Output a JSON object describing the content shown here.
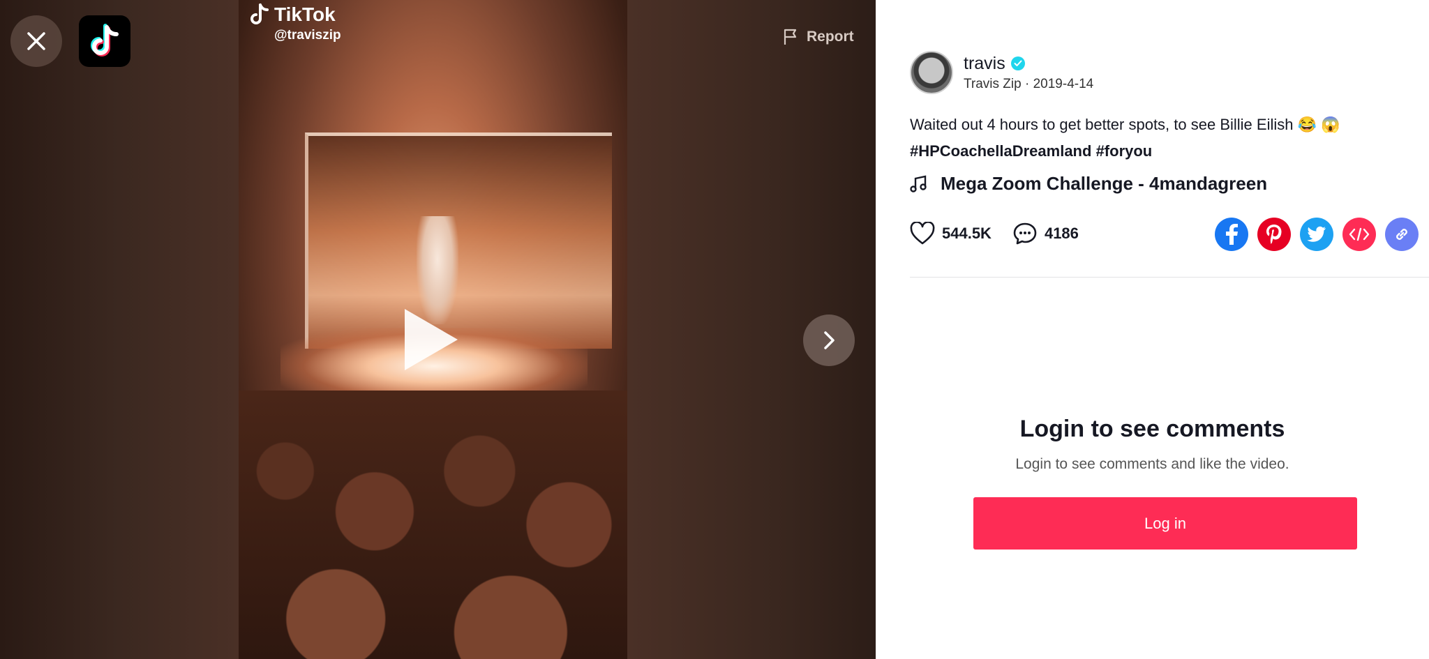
{
  "video": {
    "watermark_brand": "TikTok",
    "watermark_handle": "@traviszip",
    "report_label": "Report"
  },
  "author": {
    "username": "travis",
    "display_name": "Travis Zip",
    "date": "2019-4-14",
    "verified": true
  },
  "caption": {
    "text": "Waited out 4 hours to get better spots, to see Billie Eilish 😂 😱",
    "hashtags": [
      "#HPCoachellaDreamland",
      "#foryou"
    ]
  },
  "music": {
    "title": "Mega Zoom Challenge - 4mandagreen"
  },
  "stats": {
    "likes": "544.5K",
    "comments": "4186"
  },
  "share": [
    {
      "name": "facebook",
      "color": "#1877f2"
    },
    {
      "name": "pinterest",
      "color": "#e60023"
    },
    {
      "name": "twitter",
      "color": "#1da1f2"
    },
    {
      "name": "embed",
      "color": "#fe2c55"
    },
    {
      "name": "copy-link",
      "color": "#6a7ff5"
    }
  ],
  "comments_section": {
    "title": "Login to see comments",
    "subtitle": "Login to see comments and like the video.",
    "login_label": "Log in"
  },
  "colors": {
    "accent": "#fe2c55",
    "verified": "#20d5ec"
  }
}
